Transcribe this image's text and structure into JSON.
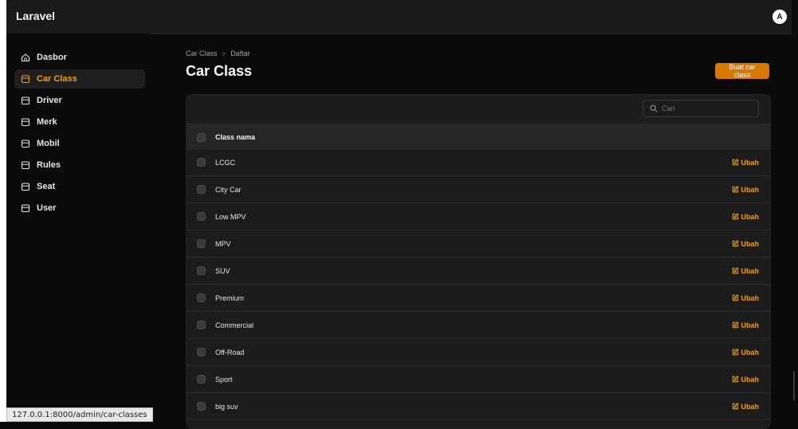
{
  "app": {
    "brand": "Laravel",
    "avatar_initial": "A"
  },
  "sidebar": {
    "items": [
      {
        "label": "Dasbor",
        "icon": "home-icon",
        "active": false
      },
      {
        "label": "Car Class",
        "icon": "box-icon",
        "active": true
      },
      {
        "label": "Driver",
        "icon": "box-icon",
        "active": false
      },
      {
        "label": "Merk",
        "icon": "box-icon",
        "active": false
      },
      {
        "label": "Mobil",
        "icon": "box-icon",
        "active": false
      },
      {
        "label": "Rules",
        "icon": "box-icon",
        "active": false
      },
      {
        "label": "Seat",
        "icon": "box-icon",
        "active": false
      },
      {
        "label": "User",
        "icon": "box-icon",
        "active": false
      }
    ]
  },
  "breadcrumb": {
    "parent": "Car Class",
    "separator": ">",
    "current": "Daftar"
  },
  "page": {
    "title": "Car Class",
    "create_label": "Buat car class"
  },
  "search": {
    "placeholder": "Cari"
  },
  "table": {
    "header": "Class nama",
    "action_label": "Ubah",
    "rows": [
      "LCGC",
      "City Car",
      "Low MPV",
      "MPV",
      "SUV",
      "Premium",
      "Commercial",
      "Off-Road",
      "Sport",
      "big suv"
    ]
  },
  "statusbar": {
    "url": "127.0.0.1:8000/admin/car-classes"
  },
  "colors": {
    "accent": "#f59e0b",
    "button": "#d97706",
    "background": "#0a0a0a",
    "panel": "#1c1c1d"
  }
}
